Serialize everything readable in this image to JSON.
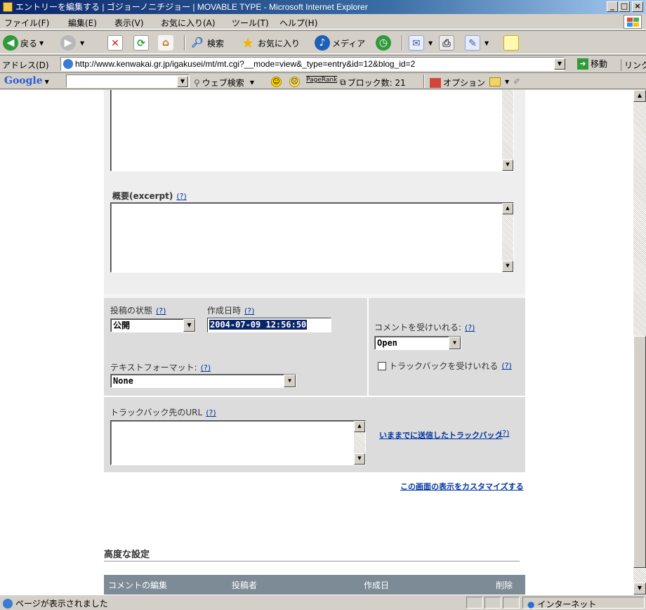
{
  "window": {
    "title": "エントリーを編集する | ゴジョーノニチジョー | MOVABLE TYPE - Microsoft Internet Explorer",
    "min_glyph": "_",
    "max_glyph": "□",
    "close_glyph": "×"
  },
  "menu": {
    "items": [
      "ファイル(F)",
      "編集(E)",
      "表示(V)",
      "お気に入り(A)",
      "ツール(T)",
      "ヘルプ(H)"
    ]
  },
  "toolbar": {
    "back": "戻る",
    "search": "検索",
    "favorites": "お気に入り",
    "media": "メディア"
  },
  "address": {
    "label": "アドレス(D)",
    "url": "http://www.kenwakai.gr.jp/igakusei/mt/mt.cgi?__mode=view&_type=entry&id=12&blog_id=2",
    "go": "移動",
    "links": "リンク"
  },
  "googlebar": {
    "logo": "Google",
    "web_search": "ウェブ検索",
    "pagerank": "PageRank",
    "blocked": "ブロック数: 21",
    "options": "オプション"
  },
  "form": {
    "excerpt_label": "概要(excerpt)",
    "help": "(?)",
    "status_label": "投稿の状態",
    "status_value": "公開",
    "created_label": "作成日時",
    "created_value": "2004-07-09 12:56:50",
    "comments_label": "コメントを受けいれる:",
    "comments_value": "Open",
    "trackback_accept_label": "トラックバックを受けいれる",
    "format_label": "テキストフォーマット:",
    "format_value": "None",
    "trackback_url_label": "トラックバック先のURL",
    "sent_trackbacks_link": "いままでに送信したトラックバック",
    "customize_link": "この画面の表示をカスタマイズする",
    "advanced_heading": "高度な設定"
  },
  "comments_table": {
    "headers": [
      "コメントの編集",
      "投稿者",
      "作成日",
      "削除"
    ]
  },
  "status": {
    "message": "ページが表示されました",
    "zone": "インターネット"
  },
  "colors": {
    "panel_bg": "#dcdcdc",
    "table_header_bg": "#7d8b96",
    "link": "#0033a0"
  }
}
